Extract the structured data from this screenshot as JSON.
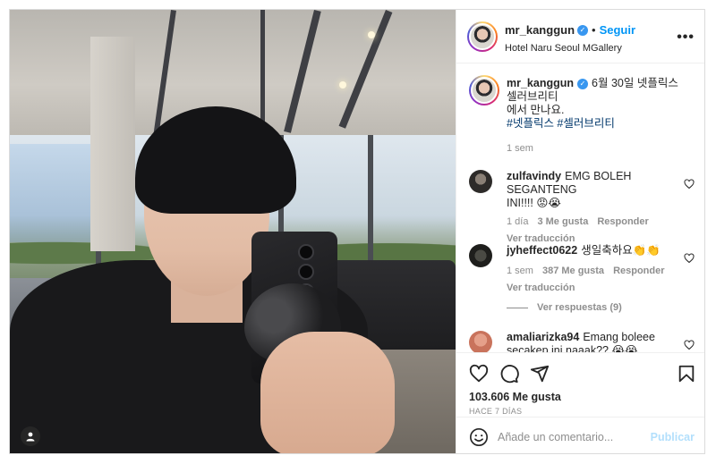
{
  "post": {
    "author": {
      "username": "mr_kanggun",
      "verified": true,
      "follow_label": "Seguir",
      "location": "Hotel Naru Seoul MGallery"
    },
    "more_icon": "more-horizontal-icon",
    "caption": {
      "username": "mr_kanggun",
      "text_line1": "6월 30일 넷플릭스",
      "text_line2": "셀러브리티",
      "text_line3": "에서 만나요.",
      "hashtags": "#넷플릭스 #셀러브리티",
      "time": "1 sem"
    },
    "comments": [
      {
        "username": "zulfavindy",
        "text_line1": "EMG BOLEH SEGANTENG",
        "text_line2": "INI!!!! 😡😭",
        "time": "1 día",
        "likes": "3 Me gusta",
        "reply_label": "Responder",
        "translate_label": "Ver traducción"
      },
      {
        "username": "jyheffect0622",
        "text_line1": "생일축하요👏👏",
        "time": "1 sem",
        "likes": "387 Me gusta",
        "reply_label": "Responder",
        "translate_label": "Ver traducción"
      },
      {
        "username": "amaliarizka94",
        "text_line1": "Emang boleee",
        "text_line2": "secakep ini naaak?? 😭😭"
      }
    ],
    "view_replies_label": "Ver respuestas (9)",
    "likes_count": "103.606 Me gusta",
    "time_ago": "HACE 7 DÍAS",
    "composer": {
      "placeholder": "Añade un comentario...",
      "publish_label": "Publicar"
    },
    "icons": {
      "like": "heart-icon",
      "comment": "comment-icon",
      "share": "send-icon",
      "save": "bookmark-icon",
      "emoji": "emoji-icon",
      "user_tag": "user-tag-icon"
    },
    "colors": {
      "link_blue": "#0095f6",
      "verified_blue": "#3897f0",
      "hashtag": "#00376b",
      "muted": "#8e8e8e",
      "publish_disabled": "#b2dffc"
    }
  }
}
